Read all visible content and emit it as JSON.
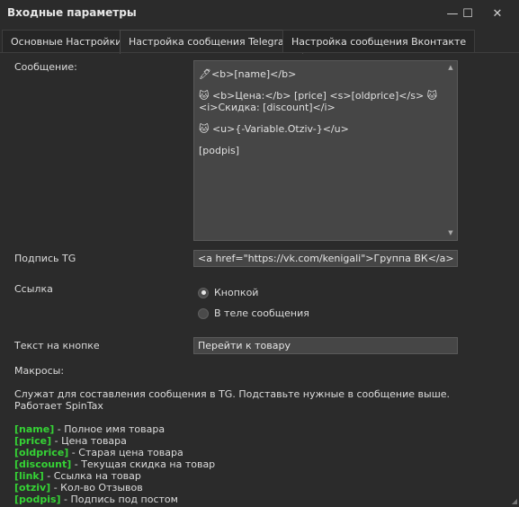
{
  "window": {
    "title": "Входные параметры",
    "minimize_glyph": "—",
    "maximize_glyph": "☐",
    "close_glyph": "✕"
  },
  "tabs": [
    {
      "label": "Основные Настройки",
      "active": false
    },
    {
      "label": "Настройка сообщения Telegram",
      "active": true
    },
    {
      "label": "Настройка сообщения Вконтакте",
      "active": false
    }
  ],
  "message": {
    "label": "Сообщение:",
    "lines": [
      "🖊<b>[name]</b>",
      "🐱 <b>Цена:</b> [price]  <s>[oldprice]</s> 🐱 <i>Скидка: [discount]</i>",
      "🐱 <u>{-Variable.Otziv-}</u>",
      "[podpis]"
    ]
  },
  "signature": {
    "label": "Подпись TG",
    "value": "<a href=\"https://vk.com/kenigali\">Группа ВК</a>"
  },
  "link": {
    "label": "Ссылка",
    "options": [
      {
        "label": "Кнопкой",
        "selected": true
      },
      {
        "label": "В теле сообщения",
        "selected": false
      }
    ]
  },
  "button_text": {
    "label": "Текст на кнопке",
    "value": "Перейти к товару"
  },
  "macros": {
    "label": "Макросы:",
    "description": "Служат для составления сообщения в TG. Подставьте нужные в сообщение выше. Работает SpinTax",
    "items": [
      {
        "key": "[name]",
        "desc": " - Полное имя товара"
      },
      {
        "key": "[price]",
        "desc": " - Цена товара"
      },
      {
        "key": "[oldprice]",
        "desc": " - Старая цена товара"
      },
      {
        "key": "[discount]",
        "desc": " - Текущая скидка на товар"
      },
      {
        "key": "[link]",
        "desc": " - Ссылка на товар"
      },
      {
        "key": "[otziv]",
        "desc": " - Кол-во Отзывов"
      },
      {
        "key": "[podpis]",
        "desc": " - Подпись под постом"
      }
    ]
  },
  "colors": {
    "macro_key": "#35d335",
    "background": "#2b2b2b",
    "field": "#464646"
  }
}
